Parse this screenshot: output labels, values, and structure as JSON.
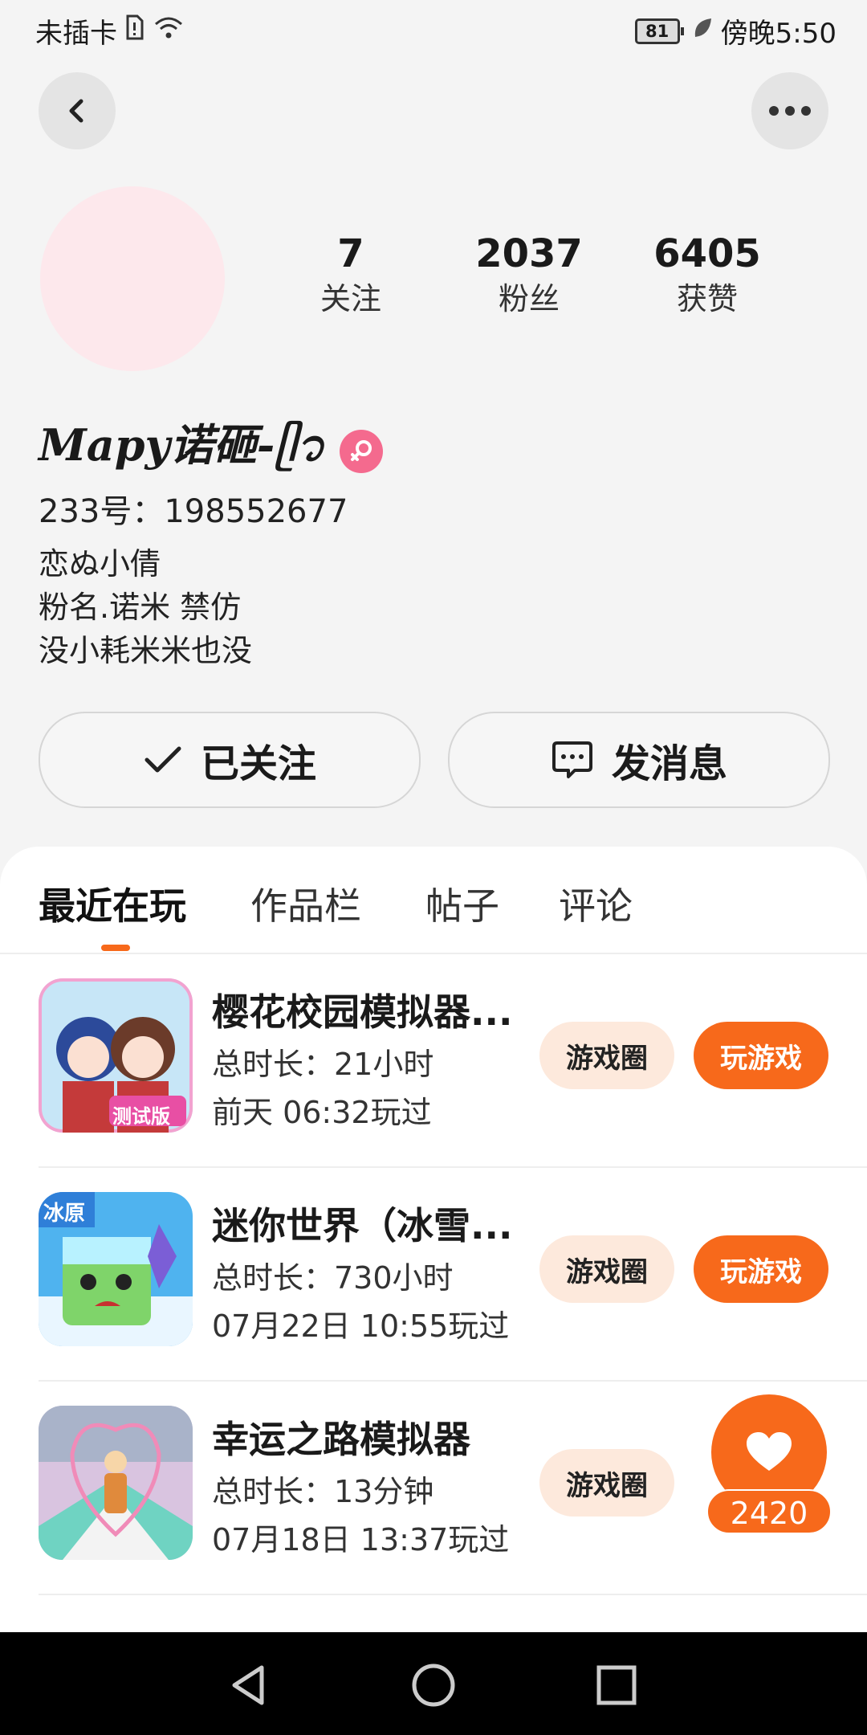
{
  "status_bar": {
    "carrier": "未插卡",
    "battery": "81",
    "time": "傍晚5:50"
  },
  "profile": {
    "stats": [
      {
        "value": "7",
        "label": "关注"
      },
      {
        "value": "2037",
        "label": "粉丝"
      },
      {
        "value": "6405",
        "label": "获赞"
      }
    ],
    "name": "Mapy诺砸-ᥫ᭡",
    "uid": "233号：198552677",
    "bio": [
      "恋ぬ小倩",
      "粉名.诺米 禁仿",
      "没小耗米米也没"
    ]
  },
  "actions": {
    "follow_label": "已关注",
    "message_label": "发消息"
  },
  "tabs": [
    "最近在玩",
    "作品栏",
    "帖子",
    "评论"
  ],
  "games": [
    {
      "title": "樱花校园模拟器...",
      "duration": "总时长：21小时",
      "last_played": "前天 06:32玩过",
      "circle_label": "游戏圈",
      "play_label": "玩游戏",
      "icon_badge": "测试版"
    },
    {
      "title": "迷你世界（冰雪...",
      "duration": "总时长：730小时",
      "last_played": "07月22日 10:55玩过",
      "circle_label": "游戏圈",
      "play_label": "玩游戏",
      "icon_badge": "冰原"
    },
    {
      "title": "幸运之路模拟器",
      "duration": "总时长：13分钟",
      "last_played": "07月18日 13:37玩过",
      "circle_label": "游戏圈"
    }
  ],
  "like_fab": {
    "count": "2420"
  },
  "colors": {
    "accent": "#f7691b",
    "accent_light": "#fde9dc",
    "gender": "#f46a8e"
  }
}
